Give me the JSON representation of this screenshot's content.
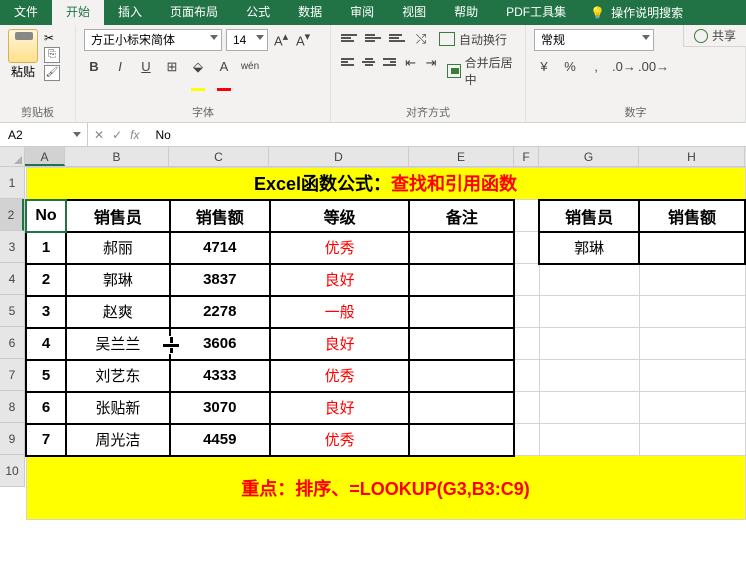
{
  "menu": {
    "file": "文件",
    "home": "开始",
    "insert": "插入",
    "layout": "页面布局",
    "formulas": "公式",
    "data": "数据",
    "review": "审阅",
    "view": "视图",
    "help": "帮助",
    "pdf": "PDF工具集",
    "tell_me": "操作说明搜索"
  },
  "share": "共享",
  "ribbon": {
    "clipboard": {
      "paste": "粘贴",
      "label": "剪贴板"
    },
    "font": {
      "name": "方正小标宋简体",
      "size": "14",
      "bold": "B",
      "italic": "I",
      "underline": "U",
      "wen": "wén",
      "label": "字体"
    },
    "alignment": {
      "wrap": "自动换行",
      "merge": "合并后居中",
      "label": "对齐方式"
    },
    "number": {
      "format": "常规",
      "label": "数字"
    }
  },
  "formula_bar": {
    "cell_ref": "A2",
    "value": "No"
  },
  "columns": [
    "A",
    "B",
    "C",
    "D",
    "E",
    "F",
    "G",
    "H"
  ],
  "row_numbers": [
    "1",
    "2",
    "3",
    "4",
    "5",
    "6",
    "7",
    "8",
    "9",
    "10"
  ],
  "banner": {
    "prefix": "Excel函数公式：",
    "suffix": "查找和引用函数"
  },
  "headers": {
    "no": "No",
    "seller": "销售员",
    "amount": "销售额",
    "grade": "等级",
    "remark": "备注"
  },
  "lookup_headers": {
    "seller": "销售员",
    "amount": "销售额"
  },
  "lookup_value": "郭琳",
  "rows": [
    {
      "no": "1",
      "seller": "郝丽",
      "amount": "4714",
      "grade": "优秀"
    },
    {
      "no": "2",
      "seller": "郭琳",
      "amount": "3837",
      "grade": "良好"
    },
    {
      "no": "3",
      "seller": "赵爽",
      "amount": "2278",
      "grade": "一般"
    },
    {
      "no": "4",
      "seller": "吴兰兰",
      "amount": "3606",
      "grade": "良好"
    },
    {
      "no": "5",
      "seller": "刘艺东",
      "amount": "4333",
      "grade": "优秀"
    },
    {
      "no": "6",
      "seller": "张贴新",
      "amount": "3070",
      "grade": "良好"
    },
    {
      "no": "7",
      "seller": "周光洁",
      "amount": "4459",
      "grade": "优秀"
    }
  ],
  "footer": {
    "prefix": "重点：",
    "suffix": "排序、=LOOKUP(G3,B3:C9)"
  }
}
